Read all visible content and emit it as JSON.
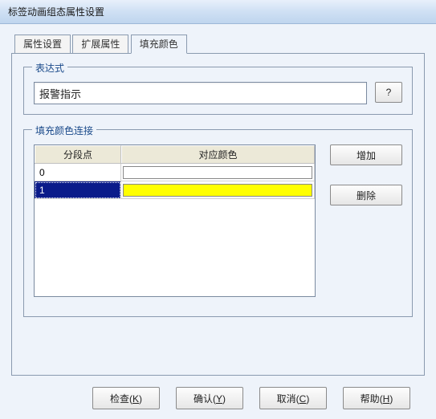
{
  "window": {
    "title": "标签动画组态属性设置"
  },
  "tabs": [
    {
      "label": "属性设置"
    },
    {
      "label": "扩展属性"
    },
    {
      "label": "填充颜色"
    }
  ],
  "expression_group": {
    "legend": "表达式",
    "value": "报警指示",
    "help_label": "?"
  },
  "fill_group": {
    "legend": "填充颜色连接",
    "columns": {
      "c1": "分段点",
      "c2": "对应颜色"
    },
    "rows": [
      {
        "point": "0",
        "color": "#ffffff",
        "selected": false
      },
      {
        "point": "1",
        "color": "#ffff00",
        "selected": true
      }
    ],
    "add_label": "增加",
    "delete_label": "删除"
  },
  "footer": {
    "check": "检查(K)",
    "ok": "确认(Y)",
    "cancel": "取消(C)",
    "help": "帮助(H)"
  }
}
